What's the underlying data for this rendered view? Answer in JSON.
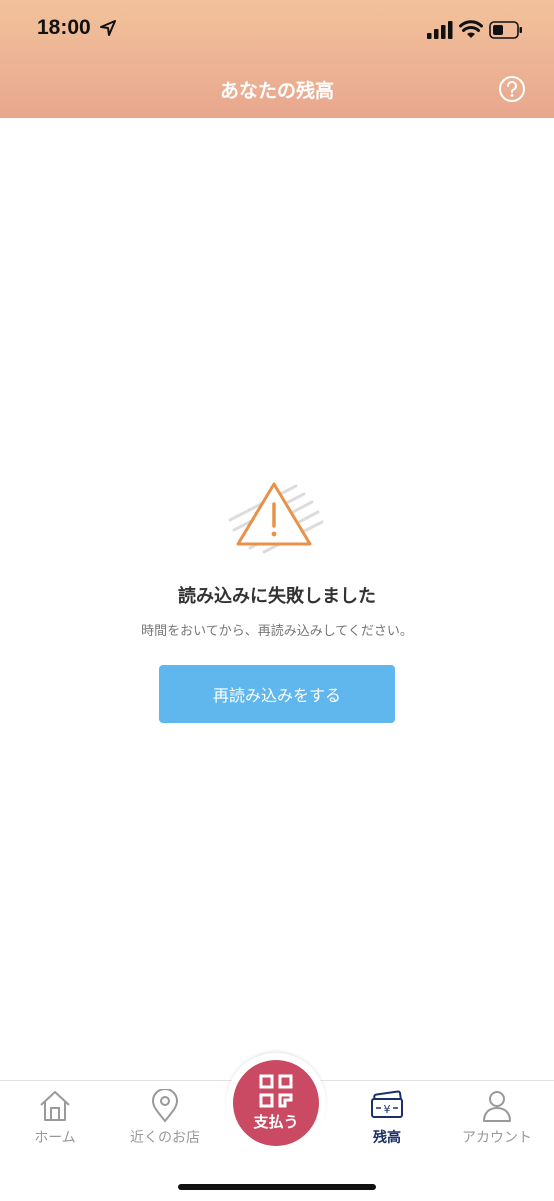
{
  "status_bar": {
    "time": "18:00"
  },
  "header": {
    "title": "あなたの残高"
  },
  "error": {
    "title": "読み込みに失敗しました",
    "description": "時間をおいてから、再読み込みしてください。",
    "reload_label": "再読み込みをする"
  },
  "tabbar": {
    "home_label": "ホーム",
    "nearby_label": "近くのお店",
    "pay_label": "支払う",
    "balance_label": "残高",
    "account_label": "アカウント"
  },
  "colors": {
    "header_top": "#f2c29b",
    "header_bottom": "#e8a78e",
    "warning": "#e8914a",
    "button": "#5fb7ee",
    "pay": "#c94a62",
    "active_tab": "#1a2f6b"
  },
  "icons": [
    "location-arrow-icon",
    "signal-icon",
    "wifi-icon",
    "battery-icon",
    "help-icon",
    "warning-icon",
    "home-icon",
    "map-pin-icon",
    "qr-code-icon",
    "wallet-icon",
    "person-icon"
  ]
}
